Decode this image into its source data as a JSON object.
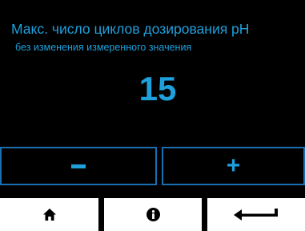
{
  "screen": {
    "title": "Макс. число циклов дозирования pH",
    "subtitle": "без изменения измеренного значения",
    "value": "15"
  },
  "controls": {
    "decrement_icon": "minus-icon",
    "increment_icon": "plus-icon",
    "increment_label": "+"
  },
  "nav": {
    "home_icon": "home-icon",
    "info_icon": "info-icon",
    "back_icon": "return-arrow-icon"
  },
  "colors": {
    "background": "#000000",
    "accent": "#1ea0dc",
    "button_border": "#1a6fb0",
    "nav_background": "#ffffff"
  }
}
